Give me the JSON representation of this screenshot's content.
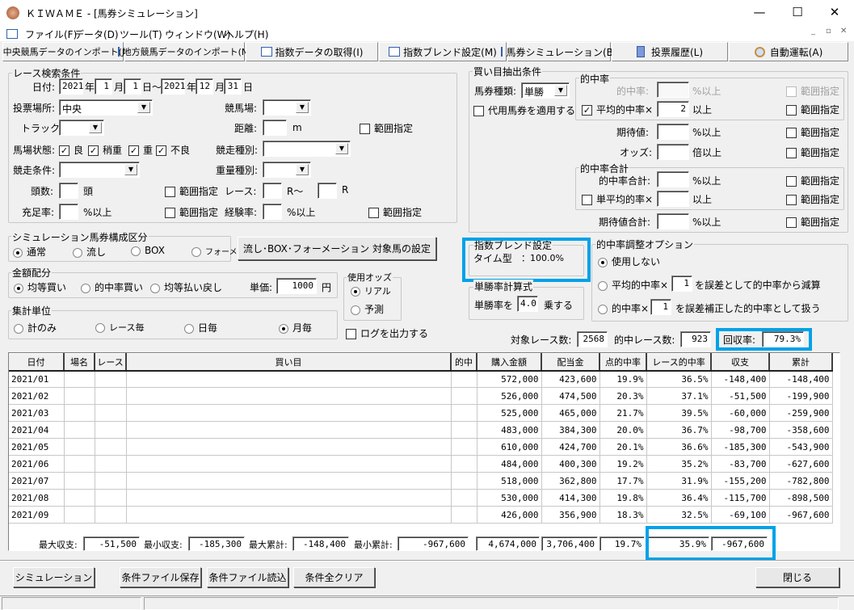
{
  "window": {
    "title": "ＫＩＷＡＭＥ - [馬券シミュレーション]",
    "minimize": "—",
    "maximize": "☐",
    "close": "✕"
  },
  "menu": [
    "ファイル(F)",
    "データ(D)",
    "ツール(T)",
    "ウィンドウ(W)",
    "ヘルプ(H)"
  ],
  "mdi": [
    "_",
    "▫",
    "✕"
  ],
  "toolbar": [
    "中央競馬データのインポート(J)",
    "地方競馬データのインポート(N)",
    "指数データの取得(I)",
    "指数ブレンド設定(M)",
    "馬券シミュレーション(B)",
    "投票履歴(L)",
    "自動運転(A)"
  ],
  "race": {
    "title": "レース検索条件",
    "date_label": "日付:",
    "from_year": "2021",
    "year": "年",
    "from_month": "1",
    "month": "月",
    "from_day": "1",
    "day_tilde": "日～",
    "to_year": "2021",
    "to_month": "12",
    "to_day": "31",
    "day": "日",
    "venue_type_label": "投票場所:",
    "venue_type": "中央",
    "track_label": "競馬場:",
    "track_type_label": "トラック:",
    "distance_label": "距離:",
    "distance_unit": "m",
    "range": "範囲指定",
    "condition_label": "馬場状態:",
    "conditions": [
      {
        "label": "良",
        "checked": true
      },
      {
        "label": "稍重",
        "checked": true
      },
      {
        "label": "重",
        "checked": true
      },
      {
        "label": "不良",
        "checked": true
      }
    ],
    "race_type_label": "競走種別:",
    "race_cond_label": "競走条件:",
    "weight_label": "重量種別:",
    "heads_label": "頭数:",
    "heads_unit": "頭",
    "race_no_label": "レース:",
    "race_from_unit": "R～",
    "race_to_unit": "R",
    "fill_label": "充足率:",
    "pct_over": "%以上",
    "exp_label": "経験率:"
  },
  "buy": {
    "title": "買い目抽出条件",
    "ticket_label": "馬券種類:",
    "ticket": "単勝",
    "substitute": "代用馬券を適用する",
    "hit_group": "的中率",
    "hit_label": "的中率:",
    "avg_hit": "平均的中率×",
    "avg_hit_value": "2",
    "over": "以上",
    "pct_over": "%以上",
    "range": "範囲指定",
    "expect_label": "期待値:",
    "odds_label": "オッズ:",
    "odds_unit": "倍以上",
    "sum_group": "的中率合計",
    "hit_sum_label": "的中率合計:",
    "single_avg": "単平均的率×",
    "expect_sum_label": "期待値合計:"
  },
  "composition": {
    "title": "シミュレーション馬券構成区分",
    "options": [
      "通常",
      "流し",
      "BOX",
      "フォーメーション"
    ],
    "selected": 0,
    "setting_button": "流し･BOX･フォーメーション 対象馬の設定"
  },
  "amount": {
    "title": "金額配分",
    "options": [
      "均等買い",
      "的中率買い",
      "均等払い戻し"
    ],
    "selected": 0,
    "unit_label": "単価:",
    "unit_value": "1000",
    "yen": "円"
  },
  "odds": {
    "title": "使用オッズ",
    "options": [
      "リアル",
      "予測"
    ],
    "selected": 0
  },
  "aggregate": {
    "title": "集計単位",
    "options": [
      "計のみ",
      "レース毎",
      "日毎",
      "月毎"
    ],
    "selected": 3
  },
  "log_output": "ログを出力する",
  "blend": {
    "title": "指数ブレンド設定",
    "type": "タイム型",
    "value": "：100.0%"
  },
  "win_rate": {
    "title": "単勝率計算式",
    "prefix": "単勝率を",
    "value": "4.0",
    "suffix": "乗する"
  },
  "adjust": {
    "title": "的中率調整オプション",
    "opt0": "使用しない",
    "opt1_prefix": "平均的中率×",
    "opt1_value": "1",
    "opt1_suffix": "を誤差として的中率から減算",
    "opt2_prefix": "的中率×",
    "opt2_value": "1",
    "opt2_suffix": "を誤差補正した的中率として扱う",
    "selected": 0
  },
  "counts": {
    "target_label": "対象レース数:",
    "target": "2568",
    "hit_label": "的中レース数:",
    "hit": "923",
    "recovery_label": "回収率:",
    "recovery": "79.3%"
  },
  "table": {
    "columns": [
      "日付",
      "場名",
      "レース",
      "買い目",
      "的中",
      "購入金額",
      "配当金",
      "点的中率",
      "レース的中率",
      "収支",
      "累計"
    ],
    "rows": [
      [
        "2021/01",
        "",
        "",
        "",
        "",
        "572,000",
        "423,600",
        "19.9%",
        "36.5%",
        "-148,400",
        "-148,400"
      ],
      [
        "2021/02",
        "",
        "",
        "",
        "",
        "526,000",
        "474,500",
        "20.3%",
        "37.1%",
        "-51,500",
        "-199,900"
      ],
      [
        "2021/03",
        "",
        "",
        "",
        "",
        "525,000",
        "465,000",
        "21.7%",
        "39.5%",
        "-60,000",
        "-259,900"
      ],
      [
        "2021/04",
        "",
        "",
        "",
        "",
        "483,000",
        "384,300",
        "20.0%",
        "36.7%",
        "-98,700",
        "-358,600"
      ],
      [
        "2021/05",
        "",
        "",
        "",
        "",
        "610,000",
        "424,700",
        "20.1%",
        "36.6%",
        "-185,300",
        "-543,900"
      ],
      [
        "2021/06",
        "",
        "",
        "",
        "",
        "484,000",
        "400,300",
        "19.2%",
        "35.2%",
        "-83,700",
        "-627,600"
      ],
      [
        "2021/07",
        "",
        "",
        "",
        "",
        "518,000",
        "362,800",
        "17.7%",
        "31.9%",
        "-155,200",
        "-782,800"
      ],
      [
        "2021/08",
        "",
        "",
        "",
        "",
        "530,000",
        "414,300",
        "19.8%",
        "36.4%",
        "-115,700",
        "-898,500"
      ],
      [
        "2021/09",
        "",
        "",
        "",
        "",
        "426,000",
        "356,900",
        "18.3%",
        "32.5%",
        "-69,100",
        "-967,600"
      ]
    ]
  },
  "summary": {
    "max_profit_label": "最大収支:",
    "max_profit": "-51,500",
    "min_profit_label": "最小収支:",
    "min_profit": "-185,300",
    "max_cum_label": "最大累計:",
    "max_cum": "-148,400",
    "min_cum_label": "最小累計:",
    "min_cum": "-967,600",
    "total_buy": "4,674,000",
    "total_pay": "3,706,400",
    "point_hit": "19.7%",
    "race_hit": "35.9%",
    "total_profit": "-967,600"
  },
  "buttons": {
    "simulate": "シミュレーション",
    "save": "条件ファイル保存",
    "load": "条件ファイル読込",
    "clear": "条件全クリア",
    "close": "閉じる"
  },
  "colors": {
    "highlight": "#00a2e8"
  }
}
